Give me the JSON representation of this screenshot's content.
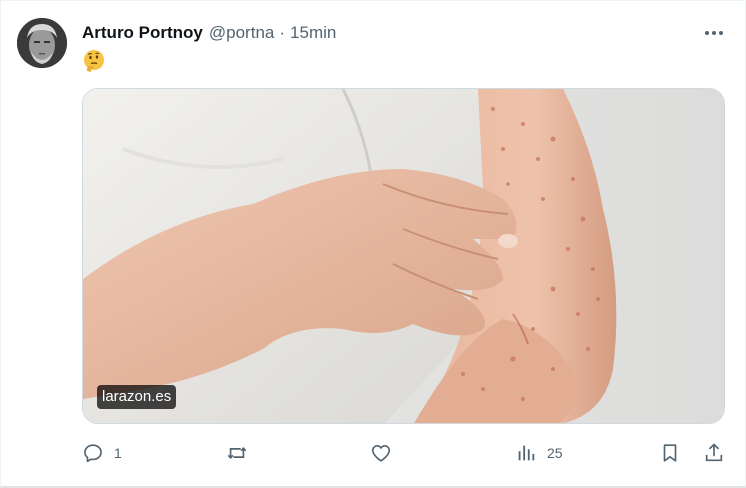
{
  "post": {
    "author_name": "Arturo Portnoy",
    "handle": "@portna",
    "separator": "·",
    "time": "15min",
    "text_emoji": "thinking-face-emoji",
    "media": {
      "source_label": "larazon.es",
      "description_icon": "arm-rash-photo"
    },
    "actions": {
      "reply_count": "1",
      "repost_count": "",
      "like_count": "",
      "views_count": "25"
    }
  },
  "icons": {
    "more": "more-horizontal-icon",
    "reply": "reply-icon",
    "repost": "repost-icon",
    "like": "like-icon",
    "views": "views-icon",
    "bookmark": "bookmark-icon",
    "share": "share-icon"
  },
  "colors": {
    "text_primary": "#0f1419",
    "text_secondary": "#536471",
    "border": "#eff3f4"
  }
}
